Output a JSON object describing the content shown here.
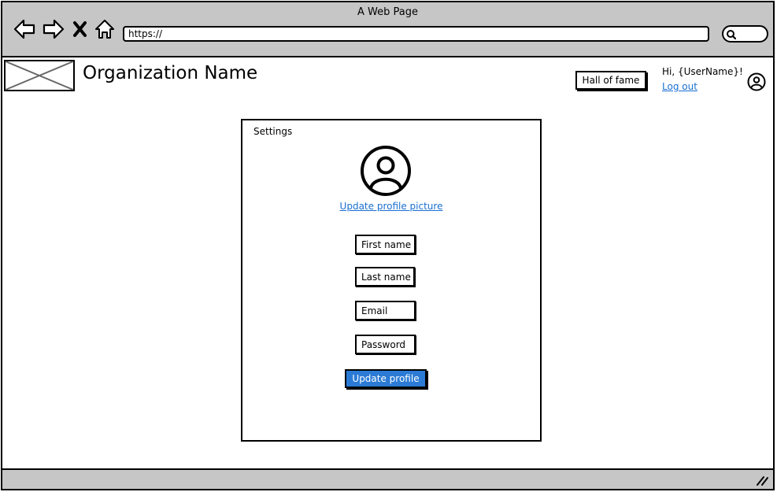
{
  "browser": {
    "window_title": "A Web Page",
    "address": "https://",
    "icons": [
      "back-arrow-icon",
      "forward-arrow-icon",
      "stop-icon",
      "home-icon",
      "search-icon"
    ]
  },
  "header": {
    "org_name": "Organization Name",
    "hall_of_fame_label": "Hall of fame",
    "greeting": "Hi, {UserName}!",
    "logout_label": "Log out"
  },
  "settings": {
    "title": "Settings",
    "update_picture_label": "Update profile picture",
    "fields": {
      "first_name": "First name",
      "last_name": "Last name",
      "email": "Email",
      "password": "Password"
    },
    "submit_label": "Update profile"
  },
  "colors": {
    "chrome_gray": "#c6c6c6",
    "link_blue": "#1a6fd1",
    "button_blue": "#2b7bd6"
  }
}
